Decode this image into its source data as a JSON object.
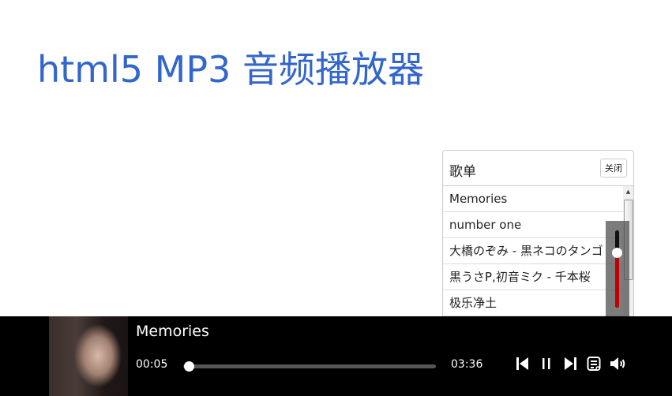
{
  "page": {
    "title": "html5 MP3 音频播放器"
  },
  "playlist": {
    "title": "歌单",
    "close_label": "关闭",
    "items": [
      {
        "label": "Memories"
      },
      {
        "label": "number one"
      },
      {
        "label": "大橋のぞみ - 黒ネコのタンゴ"
      },
      {
        "label": "黒うさP,初音ミク - 千本桜"
      },
      {
        "label": "极乐净土"
      }
    ]
  },
  "player": {
    "song_title": "Memories",
    "current_time": "00:05",
    "total_time": "03:36",
    "progress_fraction": 0.023,
    "volume_fraction": 0.7,
    "controls": {
      "prev": "skip-previous-icon",
      "pause": "pause-icon",
      "next": "skip-next-icon",
      "playlist": "playlist-icon",
      "volume": "volume-icon"
    }
  },
  "colors": {
    "accent": "#c10000",
    "title": "#3366cc",
    "player_bg": "#000000"
  }
}
